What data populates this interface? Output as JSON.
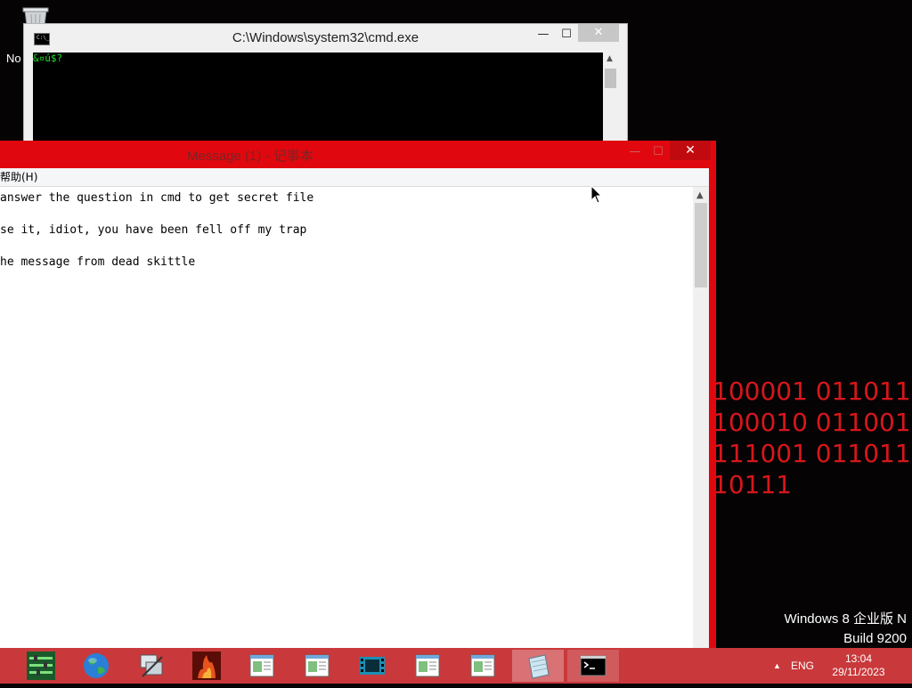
{
  "desktop": {
    "recycle_label": "No",
    "binary_lines": [
      "100001 011011",
      "100010 011001",
      "111001 011011",
      "10111"
    ],
    "os_name": "Windows 8 企业版 N",
    "os_build": "Build 9200"
  },
  "cmd": {
    "title": "C:\\Windows\\system32\\cmd.exe",
    "prompt_text": "&¤ú$?",
    "icon_text": "C:\\_"
  },
  "notepad": {
    "title": "Message (1) - 记事本",
    "menu_help": "帮助(H)",
    "lines": [
      "answer the question in cmd to get secret file",
      "se it, idiot, you have been fell off my trap",
      "he message from dead skittle"
    ]
  },
  "window_buttons": {
    "minimize": "—",
    "maximize": "☐",
    "close": "✕"
  },
  "taskbar": {
    "apps": [
      {
        "name": "app-equalizer",
        "icon": "equalizer-icon"
      },
      {
        "name": "app-globe",
        "icon": "globe-icon"
      },
      {
        "name": "app-network",
        "icon": "network-icon"
      },
      {
        "name": "app-game",
        "icon": "fire-game-icon"
      },
      {
        "name": "app-notepad-1",
        "icon": "notepad-icon"
      },
      {
        "name": "app-notepad-2",
        "icon": "notepad-icon"
      },
      {
        "name": "app-media",
        "icon": "film-icon"
      },
      {
        "name": "app-notepad-3",
        "icon": "notepad-icon"
      },
      {
        "name": "app-notepad-4",
        "icon": "notepad-icon"
      },
      {
        "name": "app-notepad-active",
        "icon": "notepad-icon"
      },
      {
        "name": "app-cmd",
        "icon": "cmd-icon"
      }
    ],
    "tray_arrow": "▲",
    "language": "ENG",
    "time": "13:04",
    "date": "29/11/2023"
  },
  "colors": {
    "accent_red": "#e0080e",
    "taskbar": "#c9393b",
    "binary": "#d8161b",
    "cmd_text": "#22e022"
  }
}
